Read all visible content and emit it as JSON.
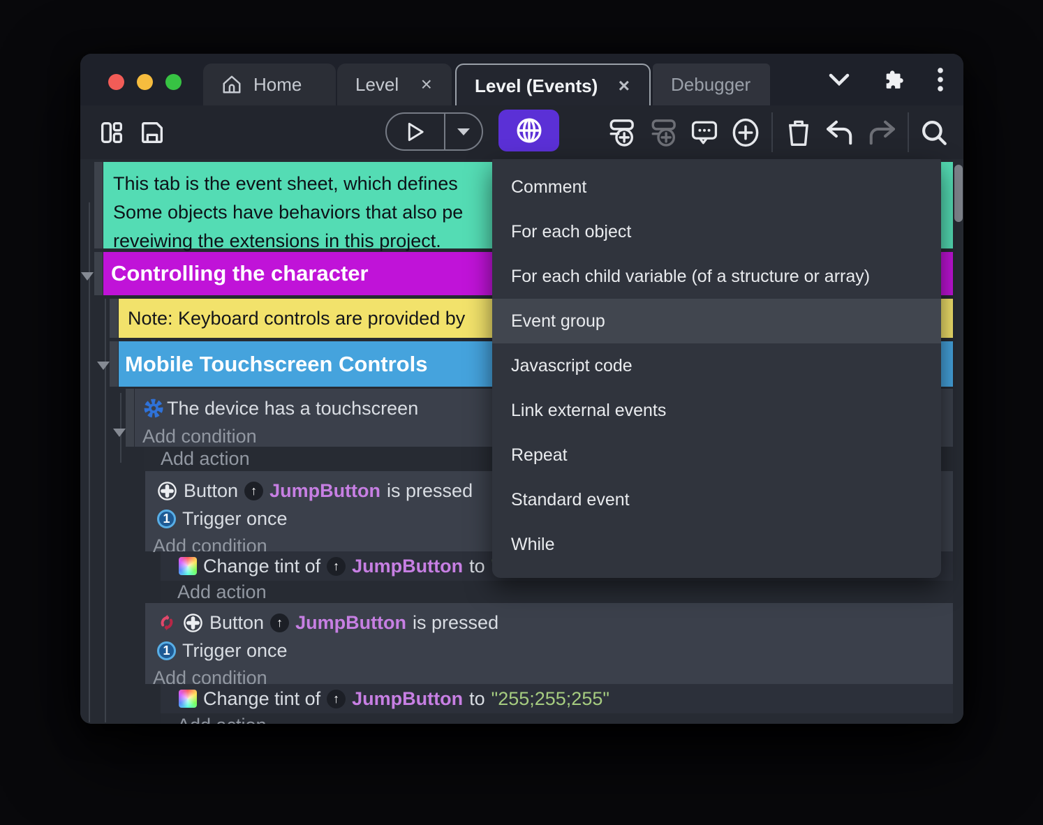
{
  "tabs": {
    "home": "Home",
    "level": "Level",
    "events": "Level (Events)",
    "debugger": "Debugger",
    "close_glyph": "×"
  },
  "toolbar": {
    "icons": [
      "panels",
      "save",
      "play",
      "play-dropdown",
      "globe",
      "add-event",
      "add-subevent",
      "comment-bubble",
      "add-circle",
      "trash",
      "undo",
      "redo",
      "search"
    ]
  },
  "menu": {
    "items": [
      "Comment",
      "For each object",
      "For each child variable (of a structure or array)",
      "Event group",
      "Javascript code",
      "Link external events",
      "Repeat",
      "Standard event",
      "While"
    ],
    "highlighted": "Event group"
  },
  "sheet": {
    "comment_lines": [
      "This tab is the event sheet, which defines",
      "Some objects have behaviors that also pe",
      "reveiwing the extensions in this project."
    ],
    "group1": "Controlling the character",
    "note": "Note: Keyboard controls are provided by",
    "group2": "Mobile Touchscreen Controls",
    "cond_touchscreen": "The device has a touchscreen",
    "add_condition": "Add condition",
    "add_action": "Add action",
    "btn_object": "Button",
    "btn_name": "JumpButton",
    "btn_suffix": "is pressed",
    "trigger_once": "Trigger once",
    "trigger_num": "1",
    "up_glyph": "↑",
    "tint_prefix": "Change tint of",
    "tint_to": "to",
    "tint_value": "\"255;255;255\""
  },
  "colors": {
    "accent_purple": "#5b30d6",
    "comment_green": "#54dcb4",
    "group_magenta": "#c013d8",
    "note_yellow": "#f2e26b",
    "group_blue": "#45a3dd",
    "object_purple": "#c77fe3",
    "string_green": "#a6cc80",
    "menu_bg": "#30343d",
    "menu_highlight": "#41464f"
  }
}
